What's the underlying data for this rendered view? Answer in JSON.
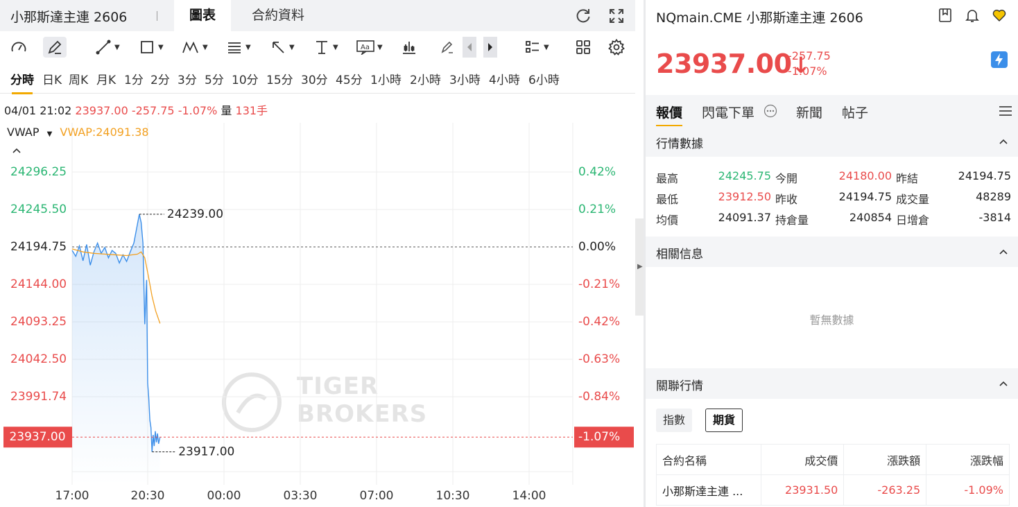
{
  "left": {
    "title": "小那斯達主連 2606",
    "tabs": [
      {
        "label": "圖表",
        "active": true
      },
      {
        "label": "合約資料",
        "active": false
      }
    ],
    "periods": [
      "分時",
      "日K",
      "周K",
      "月K",
      "1分",
      "2分",
      "3分",
      "5分",
      "10分",
      "15分",
      "30分",
      "45分",
      "1小時",
      "2小時",
      "3小時",
      "4小時",
      "6小時"
    ],
    "info": {
      "datetime": "04/01 21:02",
      "price": "23937.00",
      "change": "-257.75",
      "change_pct": "-1.07%",
      "volume_label": "量",
      "volume": "131手"
    },
    "indicator": {
      "name": "VWAP",
      "value": "VWAP:24091.38"
    },
    "watermark": {
      "line1": "TIGER",
      "line2": "BROKERS"
    }
  },
  "colors": {
    "up": "#2bb673",
    "down": "#e94b4b",
    "accent": "#f2a900",
    "price_line": "#3b8ee9",
    "vwap_line": "#f2a021"
  },
  "chart_data": {
    "type": "line",
    "title": "",
    "x_ticks": [
      "17:00",
      "20:30",
      "00:00",
      "03:30",
      "07:00",
      "10:30",
      "14:00"
    ],
    "y_ticks_left": [
      "24296.25",
      "24245.50",
      "24194.75",
      "24144.00",
      "24093.25",
      "24042.50",
      "23991.74"
    ],
    "y_ticks_right": [
      "0.42%",
      "0.21%",
      "0.00%",
      "-0.21%",
      "-0.42%",
      "-0.63%",
      "-0.84%"
    ],
    "ylim": [
      23890,
      24330
    ],
    "prev_close": 24194.75,
    "last_price": 23937.0,
    "last_price_label": "23937.00",
    "last_pct_label": "-1.07%",
    "high_label": "24239.00",
    "low_label": "23917.00",
    "high_value": 24239.0,
    "low_value": 23917.0,
    "series": [
      {
        "name": "price",
        "x": [
          "17:00",
          "17:10",
          "17:20",
          "17:30",
          "17:40",
          "17:50",
          "18:00",
          "18:10",
          "18:20",
          "18:30",
          "18:40",
          "18:50",
          "19:00",
          "19:10",
          "19:20",
          "19:30",
          "19:40",
          "19:50",
          "20:00",
          "20:05",
          "20:10",
          "20:15",
          "20:20",
          "20:25",
          "20:28",
          "20:31",
          "20:34",
          "20:37",
          "20:40",
          "20:43",
          "20:46",
          "20:49",
          "20:52",
          "20:55",
          "20:58",
          "21:02"
        ],
        "values": [
          24190,
          24182,
          24196,
          24176,
          24198,
          24170,
          24188,
          24200,
          24186,
          24194,
          24180,
          24190,
          24186,
          24173,
          24184,
          24175,
          24188,
          24200,
          24226,
          24239,
          24228,
          24200,
          24090,
          24150,
          24010,
          23990,
          23960,
          23950,
          23917,
          23940,
          23925,
          23945,
          23930,
          23942,
          23928,
          23937
        ]
      },
      {
        "name": "VWAP",
        "x": [
          "17:00",
          "17:30",
          "18:00",
          "18:30",
          "19:00",
          "19:30",
          "20:00",
          "20:10",
          "20:20",
          "20:30",
          "20:40",
          "20:50",
          "21:02"
        ],
        "values": [
          24192,
          24188,
          24186,
          24185,
          24184,
          24183,
          24185,
          24188,
          24180,
          24155,
          24128,
          24108,
          24091
        ]
      }
    ]
  },
  "right": {
    "symbol": "NQmain.CME 小那斯達主連 2606",
    "price": "23937.00",
    "arrow": "↓",
    "change": "-257.75",
    "change_pct": "-1.07%",
    "tabs": [
      "報價",
      "閃電下單",
      "新聞",
      "帖子"
    ],
    "section_quote": "行情數據",
    "stats": [
      [
        {
          "label": "最高",
          "value": "24245.75",
          "tone": "up"
        },
        {
          "label": "今開",
          "value": "24180.00",
          "tone": "down"
        },
        {
          "label": "昨結",
          "value": "24194.75",
          "tone": "neutral"
        }
      ],
      [
        {
          "label": "最低",
          "value": "23912.50",
          "tone": "down"
        },
        {
          "label": "昨收",
          "value": "24194.75",
          "tone": "neutral"
        },
        {
          "label": "成交量",
          "value": "48289",
          "tone": "neutral"
        }
      ],
      [
        {
          "label": "均價",
          "value": "24091.37",
          "tone": "neutral"
        },
        {
          "label": "持倉量",
          "value": "240854",
          "tone": "neutral"
        },
        {
          "label": "日增倉",
          "value": "-3814",
          "tone": "neutral"
        }
      ]
    ],
    "section_related": "相關信息",
    "no_data": "暫無數據",
    "section_linked": "關聯行情",
    "chips": [
      {
        "label": "指數",
        "active": false
      },
      {
        "label": "期貨",
        "active": true
      }
    ],
    "table": {
      "headers": [
        "合約名稱",
        "成交價",
        "漲跌額",
        "漲跌幅"
      ],
      "rows": [
        [
          "小那斯達主連 ...",
          "23931.50",
          "-263.25",
          "-1.09%"
        ]
      ]
    }
  }
}
